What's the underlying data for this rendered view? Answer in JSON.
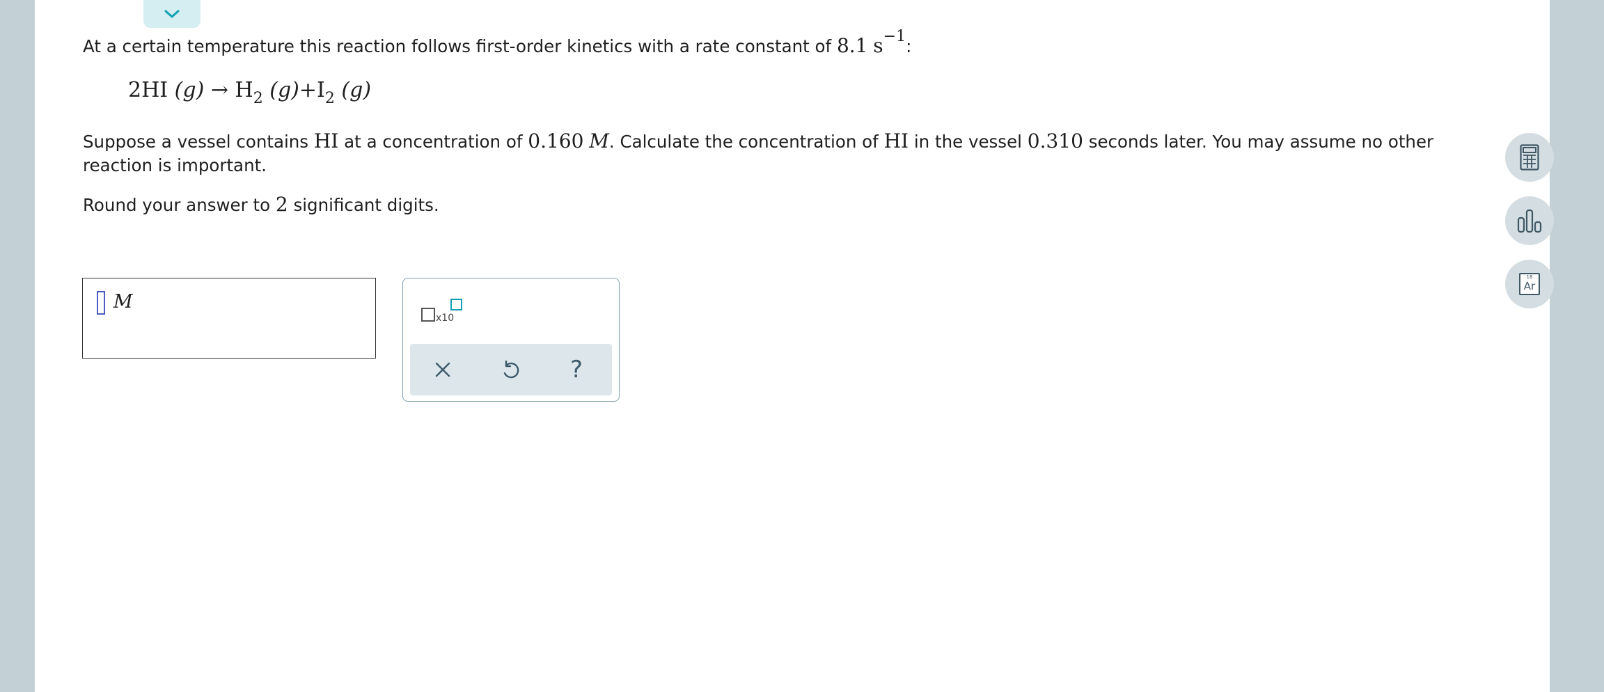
{
  "question": {
    "intro_text": "At a certain temperature this reaction follows first-order kinetics with a rate constant of",
    "rate_constant": "8.1",
    "rate_unit": "s",
    "rate_unit_exponent": "−1",
    "intro_end": ":",
    "equation": {
      "reactant_coef": "2HI",
      "reactant_phase": "(g)",
      "arrow": "→",
      "product1": "H",
      "product1_sub": "2",
      "product1_phase": "(g)",
      "plus": "+",
      "product2": "I",
      "product2_sub": "2",
      "product2_phase": "(g)"
    },
    "para_a": "Suppose a vessel contains",
    "species1": "HI",
    "para_b": "at a concentration of",
    "concentration": "0.160",
    "conc_unit": "M",
    "para_c": ". Calculate the concentration of",
    "species2": "HI",
    "para_d": "in the vessel",
    "time": "0.310",
    "para_e": "seconds later. You may assume no other reaction is important.",
    "round_a": "Round your answer to",
    "sig_digits": "2",
    "round_b": "significant digits."
  },
  "answer": {
    "value": "",
    "unit": "M"
  },
  "keypad": {
    "x10_label": "x10",
    "help_label": "?"
  },
  "tools": {
    "periodic_number": "18",
    "periodic_symbol": "Ar"
  }
}
